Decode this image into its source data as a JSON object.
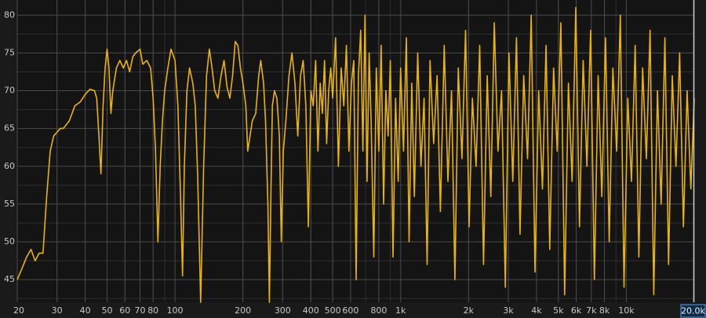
{
  "chart_data": {
    "type": "line",
    "title": "",
    "xlabel": "",
    "ylabel": "",
    "x_scale": "log",
    "xlim": [
      20,
      20000
    ],
    "ylim": [
      42,
      82
    ],
    "grid": true,
    "colors": {
      "background": "#1a1a1a",
      "plot_background": "#141414",
      "line": "#e8b40c",
      "grid": "#4a4a4a"
    },
    "y_ticks": [
      {
        "value": 45,
        "label": "45"
      },
      {
        "value": 50,
        "label": "50"
      },
      {
        "value": 55,
        "label": "55"
      },
      {
        "value": 60,
        "label": "60"
      },
      {
        "value": 65,
        "label": "65"
      },
      {
        "value": 70,
        "label": "70"
      },
      {
        "value": 75,
        "label": "75"
      },
      {
        "value": 80,
        "label": "80"
      }
    ],
    "x_ticks": [
      {
        "value": 20,
        "label": "20"
      },
      {
        "value": 30,
        "label": "30"
      },
      {
        "value": 40,
        "label": "40"
      },
      {
        "value": 50,
        "label": "50"
      },
      {
        "value": 60,
        "label": "60"
      },
      {
        "value": 70,
        "label": "70"
      },
      {
        "value": 80,
        "label": "80"
      },
      {
        "value": 100,
        "label": "100"
      },
      {
        "value": 200,
        "label": "200"
      },
      {
        "value": 300,
        "label": "300"
      },
      {
        "value": 400,
        "label": "400"
      },
      {
        "value": 500,
        "label": "500"
      },
      {
        "value": 600,
        "label": "600"
      },
      {
        "value": 800,
        "label": "800"
      },
      {
        "value": 1000,
        "label": "1k"
      },
      {
        "value": 2000,
        "label": "2k"
      },
      {
        "value": 3000,
        "label": "3k"
      },
      {
        "value": 4000,
        "label": "4k"
      },
      {
        "value": 5000,
        "label": "5k"
      },
      {
        "value": 6000,
        "label": "6k"
      },
      {
        "value": 7000,
        "label": "7k"
      },
      {
        "value": 8000,
        "label": "8k"
      },
      {
        "value": 10000,
        "label": "10k"
      }
    ],
    "cursor_readout": {
      "value": 20000,
      "label": "20.0k"
    },
    "series": [
      {
        "points": [
          [
            20,
            45
          ],
          [
            21,
            46.5
          ],
          [
            22,
            48
          ],
          [
            23,
            49
          ],
          [
            24,
            47.5
          ],
          [
            25,
            48.5
          ],
          [
            26,
            48.5
          ],
          [
            27,
            56
          ],
          [
            28,
            62
          ],
          [
            29,
            64
          ],
          [
            30,
            64.5
          ],
          [
            31,
            65
          ],
          [
            32,
            65
          ],
          [
            34,
            66
          ],
          [
            36,
            68
          ],
          [
            38,
            68.5
          ],
          [
            40,
            69.5
          ],
          [
            42,
            70.2
          ],
          [
            44,
            70
          ],
          [
            45,
            69
          ],
          [
            46,
            64
          ],
          [
            47,
            59
          ],
          [
            48,
            68
          ],
          [
            49,
            73
          ],
          [
            50,
            75.5
          ],
          [
            51,
            73
          ],
          [
            52,
            67
          ],
          [
            53,
            70
          ],
          [
            55,
            73
          ],
          [
            57,
            74
          ],
          [
            59,
            73
          ],
          [
            61,
            74
          ],
          [
            63,
            72.5
          ],
          [
            65,
            74.5
          ],
          [
            67,
            75
          ],
          [
            70,
            75.5
          ],
          [
            72,
            73.5
          ],
          [
            75,
            74
          ],
          [
            78,
            73
          ],
          [
            80,
            69
          ],
          [
            82,
            62
          ],
          [
            84,
            50
          ],
          [
            86,
            60
          ],
          [
            88,
            66
          ],
          [
            90,
            70
          ],
          [
            93,
            73
          ],
          [
            96,
            75.5
          ],
          [
            100,
            74
          ],
          [
            103,
            68
          ],
          [
            106,
            55
          ],
          [
            108,
            45.5
          ],
          [
            110,
            60
          ],
          [
            113,
            70
          ],
          [
            116,
            73
          ],
          [
            120,
            71
          ],
          [
            123,
            68
          ],
          [
            126,
            59
          ],
          [
            130,
            42
          ],
          [
            134,
            60
          ],
          [
            138,
            72
          ],
          [
            142,
            75.5
          ],
          [
            146,
            73
          ],
          [
            150,
            70
          ],
          [
            155,
            69
          ],
          [
            160,
            72
          ],
          [
            165,
            74
          ],
          [
            170,
            70.5
          ],
          [
            175,
            69
          ],
          [
            180,
            72
          ],
          [
            185,
            76.5
          ],
          [
            190,
            76
          ],
          [
            195,
            73
          ],
          [
            200,
            71
          ],
          [
            206,
            68
          ],
          [
            210,
            62
          ],
          [
            215,
            64
          ],
          [
            220,
            66
          ],
          [
            228,
            67
          ],
          [
            235,
            72
          ],
          [
            240,
            74
          ],
          [
            247,
            71
          ],
          [
            252,
            66
          ],
          [
            258,
            55
          ],
          [
            262,
            42
          ],
          [
            266,
            56
          ],
          [
            270,
            68
          ],
          [
            276,
            70
          ],
          [
            283,
            69
          ],
          [
            290,
            64
          ],
          [
            296,
            50
          ],
          [
            302,
            62
          ],
          [
            310,
            66
          ],
          [
            320,
            72
          ],
          [
            330,
            75
          ],
          [
            340,
            71
          ],
          [
            350,
            64
          ],
          [
            360,
            72
          ],
          [
            370,
            74
          ],
          [
            380,
            68
          ],
          [
            390,
            52
          ],
          [
            400,
            70
          ],
          [
            410,
            68
          ],
          [
            420,
            74
          ],
          [
            430,
            62
          ],
          [
            440,
            71
          ],
          [
            450,
            67
          ],
          [
            460,
            74
          ],
          [
            470,
            63
          ],
          [
            480,
            70
          ],
          [
            490,
            73
          ],
          [
            500,
            69
          ],
          [
            515,
            77
          ],
          [
            530,
            60
          ],
          [
            545,
            73
          ],
          [
            560,
            68
          ],
          [
            575,
            76
          ],
          [
            590,
            62
          ],
          [
            605,
            71
          ],
          [
            620,
            74
          ],
          [
            635,
            45
          ],
          [
            650,
            72
          ],
          [
            665,
            78
          ],
          [
            680,
            62
          ],
          [
            695,
            80
          ],
          [
            710,
            58
          ],
          [
            725,
            75
          ],
          [
            740,
            66
          ],
          [
            760,
            48
          ],
          [
            780,
            73
          ],
          [
            800,
            62
          ],
          [
            820,
            76
          ],
          [
            840,
            55
          ],
          [
            860,
            70
          ],
          [
            880,
            64
          ],
          [
            900,
            74
          ],
          [
            925,
            48
          ],
          [
            950,
            69
          ],
          [
            975,
            58
          ],
          [
            1000,
            73
          ],
          [
            1030,
            62
          ],
          [
            1060,
            77
          ],
          [
            1090,
            50
          ],
          [
            1120,
            71
          ],
          [
            1150,
            56
          ],
          [
            1190,
            75
          ],
          [
            1230,
            60
          ],
          [
            1270,
            69
          ],
          [
            1310,
            47
          ],
          [
            1350,
            74
          ],
          [
            1400,
            63
          ],
          [
            1450,
            72
          ],
          [
            1500,
            54
          ],
          [
            1560,
            76
          ],
          [
            1620,
            58
          ],
          [
            1680,
            70
          ],
          [
            1740,
            45
          ],
          [
            1800,
            73
          ],
          [
            1870,
            61
          ],
          [
            1940,
            78
          ],
          [
            2010,
            52
          ],
          [
            2080,
            69
          ],
          [
            2160,
            60
          ],
          [
            2240,
            76
          ],
          [
            2330,
            47
          ],
          [
            2420,
            72
          ],
          [
            2510,
            56
          ],
          [
            2600,
            79
          ],
          [
            2700,
            62
          ],
          [
            2800,
            70
          ],
          [
            2910,
            44
          ],
          [
            3020,
            75
          ],
          [
            3140,
            58
          ],
          [
            3260,
            77
          ],
          [
            3380,
            51
          ],
          [
            3510,
            72
          ],
          [
            3650,
            61
          ],
          [
            3790,
            80
          ],
          [
            3940,
            46
          ],
          [
            4090,
            70
          ],
          [
            4250,
            57
          ],
          [
            4410,
            76
          ],
          [
            4580,
            49
          ],
          [
            4760,
            73
          ],
          [
            4940,
            62
          ],
          [
            5130,
            79
          ],
          [
            5330,
            43
          ],
          [
            5540,
            71
          ],
          [
            5750,
            58
          ],
          [
            5970,
            81
          ],
          [
            6200,
            52
          ],
          [
            6440,
            74
          ],
          [
            6690,
            60
          ],
          [
            6950,
            78
          ],
          [
            7220,
            45
          ],
          [
            7500,
            72
          ],
          [
            7790,
            56
          ],
          [
            8090,
            77
          ],
          [
            8400,
            50
          ],
          [
            8720,
            73
          ],
          [
            9060,
            62
          ],
          [
            9410,
            80
          ],
          [
            9770,
            44
          ],
          [
            10150,
            69
          ],
          [
            10540,
            58
          ],
          [
            10950,
            76
          ],
          [
            11370,
            48
          ],
          [
            11810,
            73
          ],
          [
            12270,
            61
          ],
          [
            12740,
            78
          ],
          [
            13230,
            43
          ],
          [
            13740,
            70
          ],
          [
            14270,
            55
          ],
          [
            14820,
            77
          ],
          [
            15390,
            47
          ],
          [
            15990,
            72
          ],
          [
            16600,
            60
          ],
          [
            17240,
            75
          ],
          [
            17910,
            52
          ],
          [
            18600,
            70
          ],
          [
            19320,
            57
          ],
          [
            20000,
            69
          ]
        ]
      }
    ]
  }
}
